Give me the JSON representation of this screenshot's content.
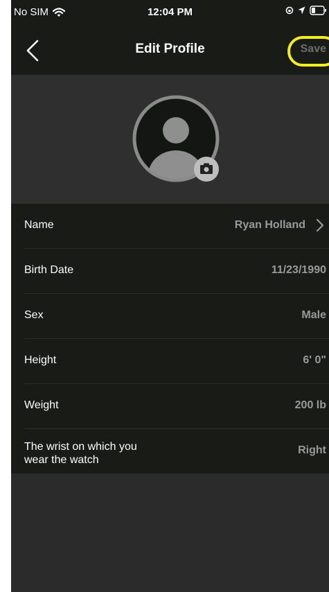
{
  "status_bar": {
    "carrier": "No SIM",
    "time": "12:04 PM",
    "icons": [
      "wifi-icon",
      "orientation-lock-icon",
      "location-icon",
      "battery-icon"
    ]
  },
  "nav": {
    "title": "Edit Profile",
    "save_label": "Save",
    "back_icon": "chevron-left-icon"
  },
  "avatar": {
    "icon": "user-placeholder-icon",
    "camera_icon": "camera-icon"
  },
  "profile_rows": [
    {
      "label": "Name",
      "value": "Ryan Holland"
    },
    {
      "label": "Birth Date",
      "value": "11/23/1990"
    },
    {
      "label": "Sex",
      "value": "Male"
    },
    {
      "label": "Height",
      "value": "6' 0\""
    },
    {
      "label": "Weight",
      "value": "200 lb"
    },
    {
      "label_line1": "The wrist on which you",
      "label_line2": "wear the watch",
      "value": "Right"
    }
  ],
  "colors": {
    "nav_background": "#181b16",
    "page_background": "#2b2b2b",
    "save_disabled": "#6e6e6e",
    "annotation_highlight": "#f5ee12",
    "value_text": "#9a9a9a"
  }
}
